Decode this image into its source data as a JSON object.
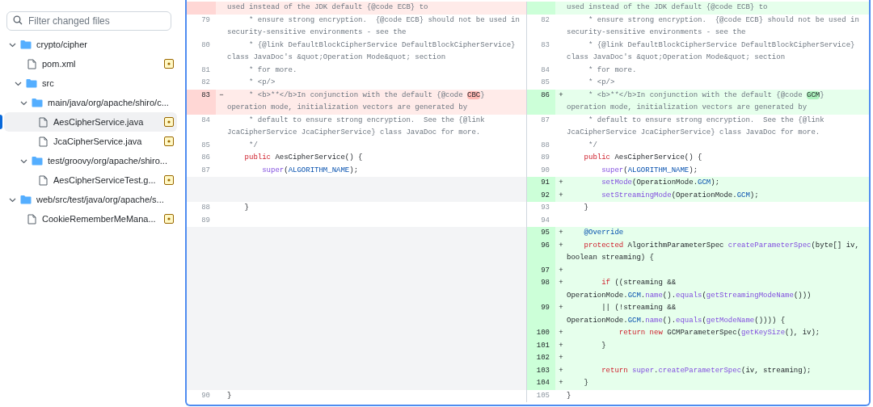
{
  "sidebar": {
    "search": {
      "placeholder": "Filter changed files"
    },
    "tree": [
      {
        "kind": "folder",
        "label": "crypto/cipher",
        "expanded": true,
        "selected": false,
        "children": [
          {
            "kind": "file",
            "label": "pom.xml",
            "selected": false,
            "changed": true
          },
          {
            "kind": "folder",
            "label": "src",
            "expanded": true,
            "selected": false,
            "children": [
              {
                "kind": "folder",
                "label": "main/java/org/apache/shiro/c...",
                "expanded": true,
                "selected": false,
                "children": [
                  {
                    "kind": "file",
                    "label": "AesCipherService.java",
                    "selected": true,
                    "changed": true
                  },
                  {
                    "kind": "file",
                    "label": "JcaCipherService.java",
                    "selected": false,
                    "changed": true
                  }
                ]
              },
              {
                "kind": "folder",
                "label": "test/groovy/org/apache/shiro...",
                "expanded": true,
                "selected": false,
                "children": [
                  {
                    "kind": "file",
                    "label": "AesCipherServiceTest.g...",
                    "selected": false,
                    "changed": true
                  }
                ]
              }
            ]
          }
        ]
      },
      {
        "kind": "folder",
        "label": "web/src/test/java/org/apache/s...",
        "expanded": true,
        "selected": false,
        "children": [
          {
            "kind": "file",
            "label": "CookieRememberMeMana...",
            "selected": false,
            "changed": true
          }
        ]
      }
    ]
  },
  "diff": {
    "rows": [
      {
        "left": {
          "kind": "del",
          "tokens": [
            {
              "kind": "comment",
              "text": "used instead of the JDK default {@code ECB} to"
            }
          ]
        },
        "right": {
          "kind": "add",
          "tokens": [
            {
              "kind": "comment",
              "text": "used instead of the JDK default {@code ECB} to"
            }
          ]
        }
      },
      {
        "left": {
          "kind": "context",
          "num": "79",
          "tokens": [
            {
              "kind": "comment",
              "text": "     * ensure strong encryption.  {@code ECB} should not be used in security-sensitive environments - see the"
            }
          ]
        },
        "right": {
          "kind": "context",
          "num": "82",
          "tokens": [
            {
              "kind": "comment",
              "text": "     * ensure strong encryption.  {@code ECB} should not be used in security-sensitive environments - see the"
            }
          ]
        }
      },
      {
        "left": {
          "kind": "context",
          "num": "80",
          "tokens": [
            {
              "kind": "comment",
              "text": "     * {@link DefaultBlockCipherService DefaultBlockCipherService} class JavaDoc's &quot;Operation Mode&quot; section"
            }
          ]
        },
        "right": {
          "kind": "context",
          "num": "83",
          "tokens": [
            {
              "kind": "comment",
              "text": "     * {@link DefaultBlockCipherService DefaultBlockCipherService} class JavaDoc's &quot;Operation Mode&quot; section"
            }
          ]
        }
      },
      {
        "left": {
          "kind": "context",
          "num": "81",
          "tokens": [
            {
              "kind": "comment",
              "text": "     * for more."
            }
          ]
        },
        "right": {
          "kind": "context",
          "num": "84",
          "tokens": [
            {
              "kind": "comment",
              "text": "     * for more."
            }
          ]
        }
      },
      {
        "left": {
          "kind": "context",
          "num": "82",
          "tokens": [
            {
              "kind": "comment",
              "text": "     * <p/>"
            }
          ]
        },
        "right": {
          "kind": "context",
          "num": "85",
          "tokens": [
            {
              "kind": "comment",
              "text": "     * <p/>"
            }
          ]
        }
      },
      {
        "left": {
          "kind": "del",
          "num": "83",
          "marker": "−",
          "tokens": [
            {
              "kind": "comment",
              "text": "     * <b>**</b>In conjunction with the default {@code "
            },
            {
              "kind": "mark",
              "text": "CBC"
            },
            {
              "kind": "comment",
              "text": "} operation mode, initialization vectors are generated by"
            }
          ]
        },
        "right": {
          "kind": "add",
          "num": "86",
          "marker": "+",
          "tokens": [
            {
              "kind": "comment",
              "text": "     * <b>**</b>In conjunction with the default {@code "
            },
            {
              "kind": "mark",
              "text": "GCM"
            },
            {
              "kind": "comment",
              "text": "} operation mode, initialization vectors are generated by"
            }
          ]
        }
      },
      {
        "left": {
          "kind": "context",
          "num": "84",
          "tokens": [
            {
              "kind": "comment",
              "text": "     * default to ensure strong encryption.  See the {@link JcaCipherService JcaCipherService} class JavaDoc for more."
            }
          ]
        },
        "right": {
          "kind": "context",
          "num": "87",
          "tokens": [
            {
              "kind": "comment",
              "text": "     * default to ensure strong encryption.  See the {@link JcaCipherService JcaCipherService} class JavaDoc for more."
            }
          ]
        }
      },
      {
        "left": {
          "kind": "context",
          "num": "85",
          "tokens": [
            {
              "kind": "comment",
              "text": "     */"
            }
          ]
        },
        "right": {
          "kind": "context",
          "num": "88",
          "tokens": [
            {
              "kind": "comment",
              "text": "     */"
            }
          ]
        }
      },
      {
        "left": {
          "kind": "context",
          "num": "86",
          "tokens": [
            {
              "kind": "keyword",
              "text": "    public"
            },
            {
              "kind": "plain",
              "text": " AesCipherService() {"
            }
          ]
        },
        "right": {
          "kind": "context",
          "num": "89",
          "tokens": [
            {
              "kind": "keyword",
              "text": "    public"
            },
            {
              "kind": "plain",
              "text": " AesCipherService() {"
            }
          ]
        }
      },
      {
        "left": {
          "kind": "context",
          "num": "87",
          "tokens": [
            {
              "kind": "function",
              "text": "        super"
            },
            {
              "kind": "plain",
              "text": "("
            },
            {
              "kind": "constant",
              "text": "ALGORITHM_NAME"
            },
            {
              "kind": "plain",
              "text": ");"
            }
          ]
        },
        "right": {
          "kind": "context",
          "num": "90",
          "tokens": [
            {
              "kind": "function",
              "text": "        super"
            },
            {
              "kind": "plain",
              "text": "("
            },
            {
              "kind": "constant",
              "text": "ALGORITHM_NAME"
            },
            {
              "kind": "plain",
              "text": ");"
            }
          ]
        }
      },
      {
        "left": null,
        "right": {
          "kind": "add",
          "num": "91",
          "marker": "+",
          "tokens": [
            {
              "kind": "function",
              "text": "        setMode"
            },
            {
              "kind": "plain",
              "text": "(OperationMode."
            },
            {
              "kind": "constant",
              "text": "GCM"
            },
            {
              "kind": "plain",
              "text": ");"
            }
          ]
        }
      },
      {
        "left": null,
        "right": {
          "kind": "add",
          "num": "92",
          "marker": "+",
          "tokens": [
            {
              "kind": "function",
              "text": "        setStreamingMode"
            },
            {
              "kind": "plain",
              "text": "(OperationMode."
            },
            {
              "kind": "constant",
              "text": "GCM"
            },
            {
              "kind": "plain",
              "text": ");"
            }
          ]
        }
      },
      {
        "left": {
          "kind": "context",
          "num": "88",
          "tokens": [
            {
              "kind": "plain",
              "text": "    }"
            }
          ]
        },
        "right": {
          "kind": "context",
          "num": "93",
          "tokens": [
            {
              "kind": "plain",
              "text": "    }"
            }
          ]
        }
      },
      {
        "left": {
          "kind": "context",
          "num": "89"
        },
        "right": {
          "kind": "context",
          "num": "94"
        }
      },
      {
        "left": null,
        "right": {
          "kind": "add",
          "num": "95",
          "marker": "+",
          "tokens": [
            {
              "kind": "constant",
              "text": "    @Override"
            }
          ]
        }
      },
      {
        "left": null,
        "right": {
          "kind": "add",
          "num": "96",
          "marker": "+",
          "tokens": [
            {
              "kind": "keyword",
              "text": "    protected"
            },
            {
              "kind": "plain",
              "text": " AlgorithmParameterSpec "
            },
            {
              "kind": "function",
              "text": "createParameterSpec"
            },
            {
              "kind": "plain",
              "text": "(byte[] iv, boolean streaming) {"
            }
          ]
        }
      },
      {
        "left": null,
        "right": {
          "kind": "add",
          "num": "97",
          "marker": "+"
        }
      },
      {
        "left": null,
        "right": {
          "kind": "add",
          "num": "98",
          "marker": "+",
          "tokens": [
            {
              "kind": "keyword",
              "text": "        if"
            },
            {
              "kind": "plain",
              "text": " ((streaming && OperationMode."
            },
            {
              "kind": "constant",
              "text": "GCM"
            },
            {
              "kind": "plain",
              "text": "."
            },
            {
              "kind": "function",
              "text": "name"
            },
            {
              "kind": "plain",
              "text": "()."
            },
            {
              "kind": "function",
              "text": "equals"
            },
            {
              "kind": "plain",
              "text": "("
            },
            {
              "kind": "function",
              "text": "getStreamingModeName"
            },
            {
              "kind": "plain",
              "text": "()))"
            }
          ]
        }
      },
      {
        "left": null,
        "right": {
          "kind": "add",
          "num": "99",
          "marker": "+",
          "tokens": [
            {
              "kind": "plain",
              "text": "        || (!streaming && OperationMode."
            },
            {
              "kind": "constant",
              "text": "GCM"
            },
            {
              "kind": "plain",
              "text": "."
            },
            {
              "kind": "function",
              "text": "name"
            },
            {
              "kind": "plain",
              "text": "()."
            },
            {
              "kind": "function",
              "text": "equals"
            },
            {
              "kind": "plain",
              "text": "("
            },
            {
              "kind": "function",
              "text": "getModeName"
            },
            {
              "kind": "plain",
              "text": "()))) {"
            }
          ]
        }
      },
      {
        "left": null,
        "right": {
          "kind": "add",
          "num": "100",
          "marker": "+",
          "tokens": [
            {
              "kind": "keyword",
              "text": "            return"
            },
            {
              "kind": "keyword",
              "text": " new"
            },
            {
              "kind": "plain",
              "text": " GCMParameterSpec("
            },
            {
              "kind": "function",
              "text": "getKeySize"
            },
            {
              "kind": "plain",
              "text": "(), iv);"
            }
          ]
        }
      },
      {
        "left": null,
        "right": {
          "kind": "add",
          "num": "101",
          "marker": "+",
          "tokens": [
            {
              "kind": "plain",
              "text": "        }"
            }
          ]
        }
      },
      {
        "left": null,
        "right": {
          "kind": "add",
          "num": "102",
          "marker": "+"
        }
      },
      {
        "left": null,
        "right": {
          "kind": "add",
          "num": "103",
          "marker": "+",
          "tokens": [
            {
              "kind": "keyword",
              "text": "        return"
            },
            {
              "kind": "function",
              "text": " super"
            },
            {
              "kind": "plain",
              "text": "."
            },
            {
              "kind": "function",
              "text": "createParameterSpec"
            },
            {
              "kind": "plain",
              "text": "(iv, streaming);"
            }
          ]
        }
      },
      {
        "left": null,
        "right": {
          "kind": "add",
          "num": "104",
          "marker": "+",
          "tokens": [
            {
              "kind": "plain",
              "text": "    }"
            }
          ]
        }
      },
      {
        "left": {
          "kind": "context",
          "num": "90",
          "tokens": [
            {
              "kind": "plain",
              "text": "}"
            }
          ]
        },
        "right": {
          "kind": "context",
          "num": "105",
          "tokens": [
            {
              "kind": "plain",
              "text": "}"
            }
          ]
        }
      }
    ]
  }
}
